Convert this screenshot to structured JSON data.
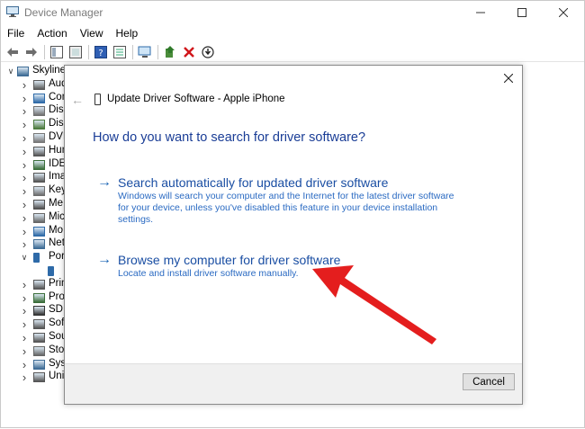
{
  "window": {
    "title": "Device Manager",
    "icon": "device-manager-icon"
  },
  "menu": [
    "File",
    "Action",
    "View",
    "Help"
  ],
  "toolbar": {
    "icons": [
      "back-arrow-icon",
      "forward-arrow-icon",
      "properties-pane-icon",
      "list-view-icon",
      "help-icon",
      "details-icon",
      "monitor-scan-icon",
      "update-driver-icon",
      "uninstall-x-icon",
      "download-circle-icon"
    ]
  },
  "tree": {
    "items": [
      {
        "label": "Skyline",
        "icon": "computer-icon",
        "chevron": "expanded"
      },
      {
        "label": "Aud",
        "icon": "speaker-icon",
        "chevron": "collapsed"
      },
      {
        "label": "Com",
        "icon": "monitor-icon",
        "chevron": "collapsed"
      },
      {
        "label": "Disk",
        "icon": "disk-drive-icon",
        "chevron": "collapsed"
      },
      {
        "label": "Disp",
        "icon": "display-adapter-icon",
        "chevron": "collapsed"
      },
      {
        "label": "DVD",
        "icon": "dvd-drive-icon",
        "chevron": "collapsed"
      },
      {
        "label": "Hum",
        "icon": "hid-icon",
        "chevron": "collapsed"
      },
      {
        "label": "IDE",
        "icon": "ide-controller-icon",
        "chevron": "collapsed"
      },
      {
        "label": "Ima",
        "icon": "camera-icon",
        "chevron": "collapsed"
      },
      {
        "label": "Key",
        "icon": "keyboard-icon",
        "chevron": "collapsed"
      },
      {
        "label": "Me",
        "icon": "memory-icon",
        "chevron": "collapsed"
      },
      {
        "label": "Mic",
        "icon": "mouse-icon",
        "chevron": "collapsed"
      },
      {
        "label": "Mo",
        "icon": "monitor-icon",
        "chevron": "collapsed"
      },
      {
        "label": "Net",
        "icon": "network-adapter-icon",
        "chevron": "collapsed"
      },
      {
        "label": "Por",
        "icon": "portable-device-icon",
        "chevron": "expanded"
      },
      {
        "label": "",
        "icon": "iphone-icon",
        "chevron": "none"
      },
      {
        "label": "Prin",
        "icon": "printer-icon",
        "chevron": "collapsed"
      },
      {
        "label": "Pro",
        "icon": "processor-icon",
        "chevron": "collapsed"
      },
      {
        "label": "SD",
        "icon": "sd-host-icon",
        "chevron": "collapsed"
      },
      {
        "label": "Sof",
        "icon": "software-device-icon",
        "chevron": "collapsed"
      },
      {
        "label": "Sou",
        "icon": "sound-icon",
        "chevron": "collapsed"
      },
      {
        "label": "Sto",
        "icon": "storage-controller-icon",
        "chevron": "collapsed"
      },
      {
        "label": "Sys",
        "icon": "system-device-icon",
        "chevron": "collapsed"
      },
      {
        "label": "Uni",
        "icon": "usb-icon",
        "chevron": "collapsed"
      }
    ]
  },
  "dialog": {
    "title": "Update Driver Software - Apple iPhone",
    "heading": "How do you want to search for driver software?",
    "options": [
      {
        "title": "Search automatically for updated driver software",
        "description": "Windows will search your computer and the Internet for the latest driver software for your device, unless you've disabled this feature in your device installation settings."
      },
      {
        "title": "Browse my computer for driver software",
        "description": "Locate and install driver software manually."
      }
    ],
    "cancel_label": "Cancel"
  },
  "annotation": {
    "color": "#e41e1e",
    "points_to": "Browse my computer for driver software"
  }
}
